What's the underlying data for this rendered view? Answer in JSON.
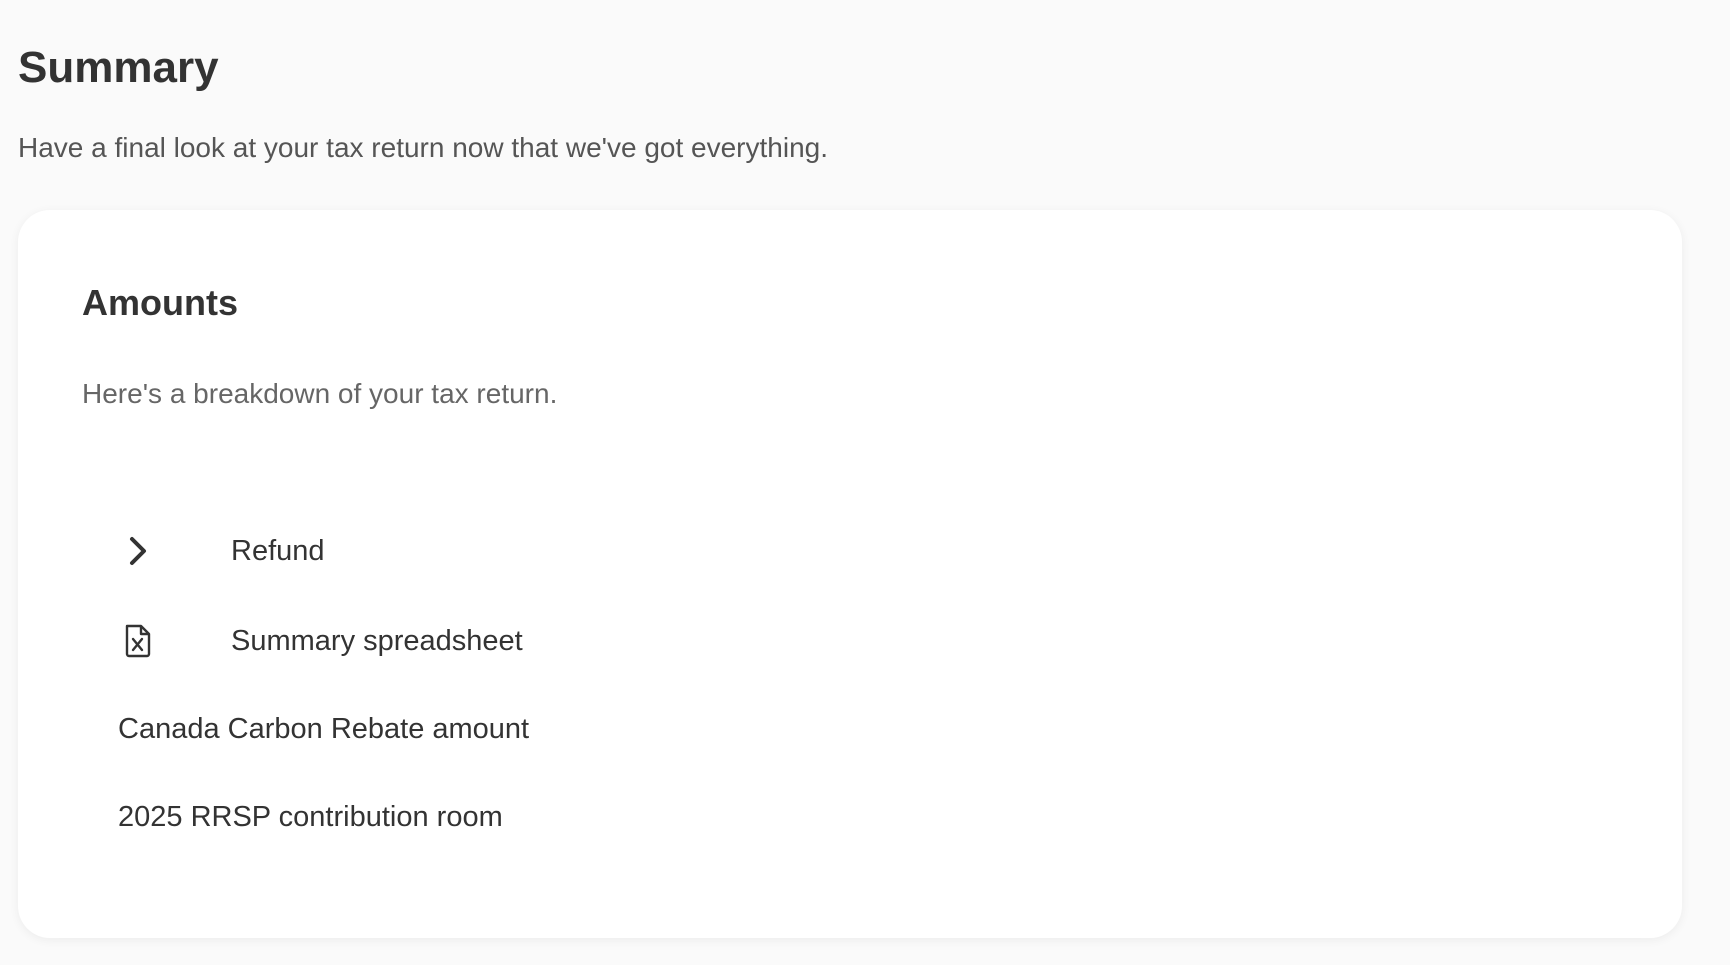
{
  "header": {
    "title": "Summary",
    "subtitle": "Have a final look at your tax return now that we've got everything."
  },
  "card": {
    "title": "Amounts",
    "description": "Here's a breakdown of your tax return.",
    "items": [
      {
        "label": "Refund",
        "icon": "chevron-right-icon"
      },
      {
        "label": "Summary spreadsheet",
        "icon": "spreadsheet-file-icon"
      },
      {
        "label": "Canada Carbon Rebate amount"
      },
      {
        "label": "2025 RRSP contribution room"
      }
    ]
  },
  "colors": {
    "background": "#fafafa",
    "card": "#ffffff",
    "text": "#333333",
    "muted_text": "#666666"
  }
}
